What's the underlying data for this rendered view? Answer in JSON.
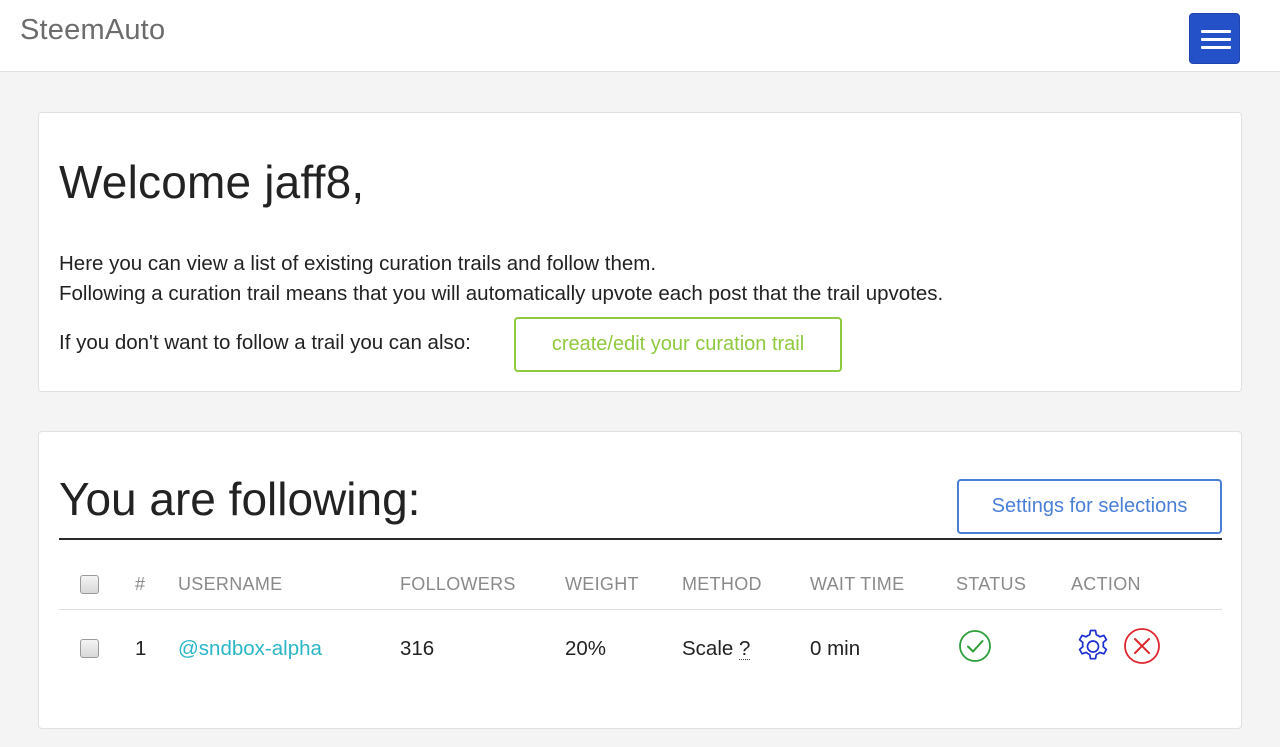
{
  "navbar": {
    "brand": "SteemAuto",
    "menu_icon": "hamburger-menu-icon",
    "menu_color": "#2551c8"
  },
  "welcome": {
    "title": "Welcome jaff8,",
    "line1": "Here you can view a list of existing curation trails and follow them.",
    "line2": "Following a curation trail means that you will automatically upvote each post that the trail upvotes.",
    "line3": "If you don't want to follow a trail you can also:",
    "button_label": "create/edit your curation trail",
    "button_color": "#8fc93f"
  },
  "following": {
    "title": "You are following:",
    "settings_button": "Settings for selections",
    "settings_color": "#4a7fd8",
    "columns": {
      "num": "#",
      "username": "USERNAME",
      "followers": "FOLLOWERS",
      "weight": "WEIGHT",
      "method": "METHOD",
      "wait_time": "WAIT TIME",
      "status": "STATUS",
      "action": "ACTION"
    },
    "rows": [
      {
        "num": "1",
        "username": "@sndbox-alpha",
        "followers": "316",
        "weight": "20%",
        "method": "Scale",
        "method_help": "?",
        "wait_time": "0 min",
        "status_icon": "check-circle-icon",
        "status_color": "#2e9e3a",
        "actions": [
          {
            "icon": "gear-icon",
            "color": "#1c2fd0"
          },
          {
            "icon": "close-circle-icon",
            "color": "#e0262e"
          }
        ]
      }
    ]
  }
}
